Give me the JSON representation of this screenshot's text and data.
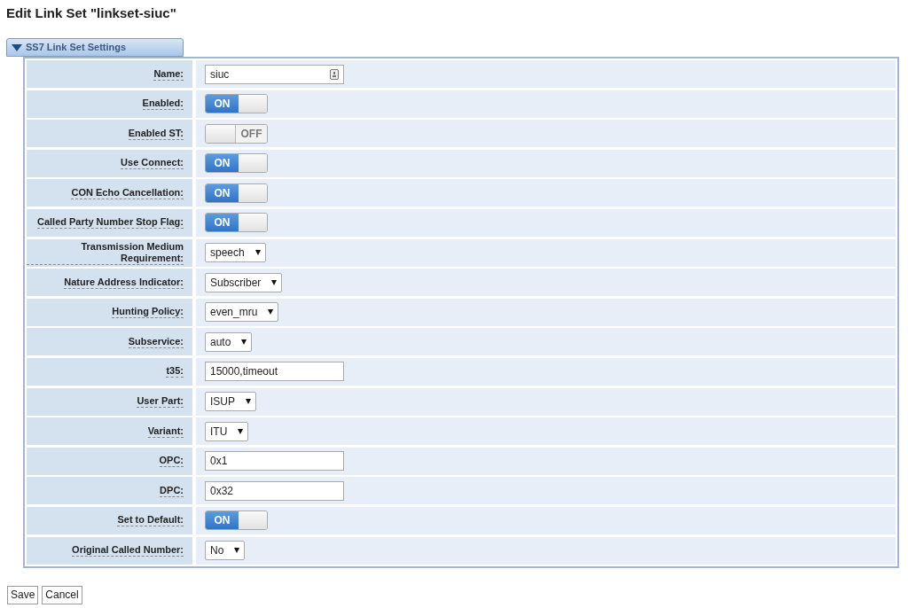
{
  "title": "Edit Link Set \"linkset-siuc\"",
  "panel": {
    "title": "SS7 Link Set Settings",
    "expanded": true
  },
  "rows": [
    {
      "label": "Name:",
      "kind": "text",
      "value": "siuc",
      "has_icon": true
    },
    {
      "label": "Enabled:",
      "kind": "toggle",
      "on": true,
      "text": "ON"
    },
    {
      "label": "Enabled ST:",
      "kind": "toggle",
      "on": false,
      "text": "OFF"
    },
    {
      "label": "Use Connect:",
      "kind": "toggle",
      "on": true,
      "text": "ON"
    },
    {
      "label": "CON Echo Cancellation:",
      "kind": "toggle",
      "on": true,
      "text": "ON"
    },
    {
      "label": "Called Party Number Stop Flag:",
      "kind": "toggle",
      "on": true,
      "text": "ON"
    },
    {
      "label": "Transmission Medium Requirement:",
      "kind": "select",
      "value": "speech"
    },
    {
      "label": "Nature Address Indicator:",
      "kind": "select",
      "value": "Subscriber"
    },
    {
      "label": "Hunting Policy:",
      "kind": "select",
      "value": "even_mru"
    },
    {
      "label": "Subservice:",
      "kind": "select",
      "value": "auto"
    },
    {
      "label": "t35:",
      "kind": "text",
      "value": "15000,timeout",
      "has_icon": false
    },
    {
      "label": "User Part:",
      "kind": "select",
      "value": "ISUP"
    },
    {
      "label": "Variant:",
      "kind": "select",
      "value": "ITU"
    },
    {
      "label": "OPC:",
      "kind": "text",
      "value": "0x1",
      "has_icon": false
    },
    {
      "label": "DPC:",
      "kind": "text",
      "value": "0x32",
      "has_icon": false
    },
    {
      "label": "Set to Default:",
      "kind": "toggle",
      "on": true,
      "text": "ON"
    },
    {
      "label": "Original Called Number:",
      "kind": "select",
      "value": "No"
    }
  ],
  "buttons": [
    "Save",
    "Cancel"
  ]
}
